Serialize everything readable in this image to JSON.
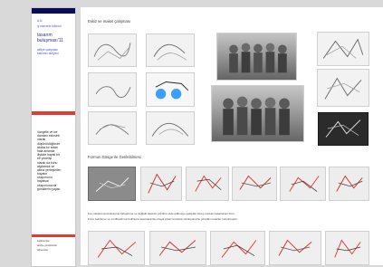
{
  "sidebar": {
    "header_small": "A.Ü.",
    "dept": "iç mimarlık bölümü",
    "title_line1": "tasarım",
    "title_line2": "buluşması'11",
    "subtitle_line1": "atölye çalışması",
    "subtitle_line2": "katılımcı atölyesi",
    "body_lines": [
      "Vangelis ve ice",
      "damlası esinsinli",
      "olarak",
      "düşünüldüğünde",
      "akılda kır anları",
      "hala anlamla",
      "ilişkide hayati bir",
      "bir yönelişi",
      "olarak da bunu",
      "algılamak ve",
      "altına yerleştirilen",
      "hayatın",
      "oluşumunu",
      "hayatsal",
      "oluşumuna da",
      "gönüllerini yayan"
    ],
    "footer_lines": [
      "katılımcılar:",
      "atölye yürütücüsü",
      "öğrenciler"
    ]
  },
  "main": {
    "section1_title": "Eskiz ve maket çalışması",
    "section2_title": "Formun Gösge ile Gerilebilmesi",
    "caption_lines": [
      "Fon sıkıştırma fonksiyonu birleştirme ve değişik tasarım çözümü elde edilmeye çalışılan süreç sonrası tasarlanan form.",
      "Form belirleme ve sınıflandırma belirleme aşamasında ortaya çıkan formların dönüşümüne yönelik modeller sunulmuştur."
    ]
  }
}
